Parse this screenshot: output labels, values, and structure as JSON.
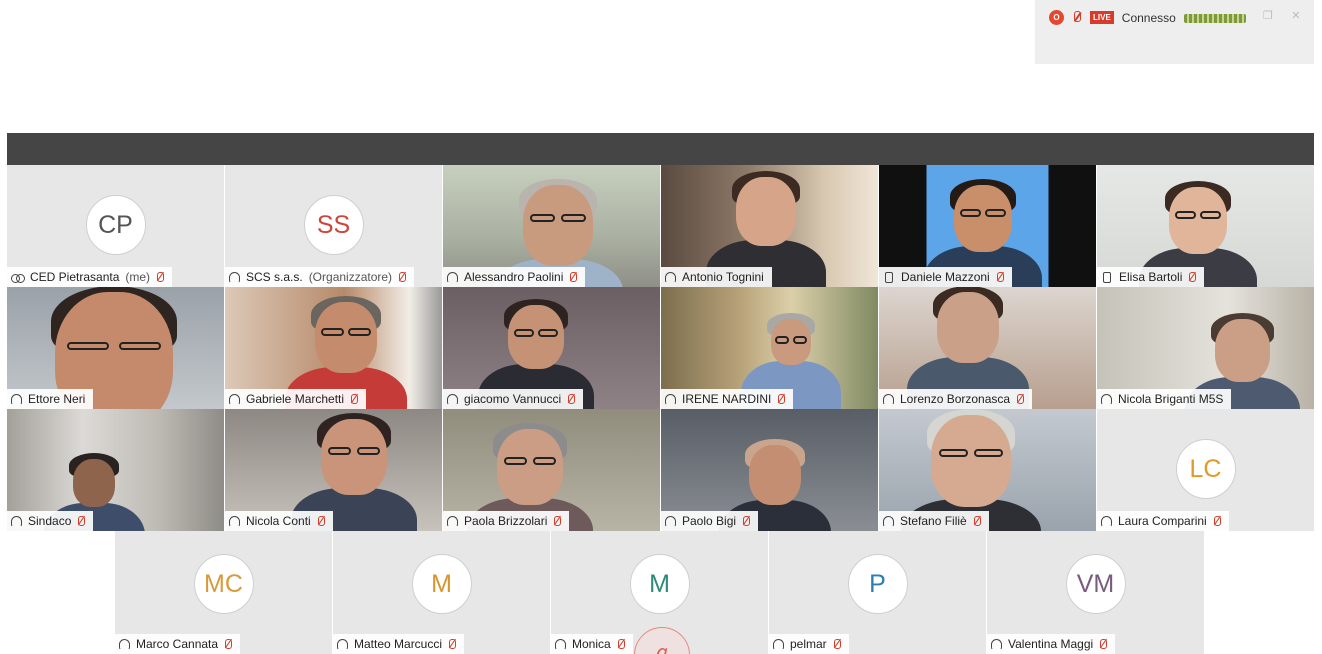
{
  "status": {
    "rec": "O",
    "live": "LIVE",
    "connection": "Connesso",
    "restore": "❐",
    "close": "✕"
  },
  "participants": [
    {
      "name": "CED Pietrasanta",
      "role": "(me)",
      "avatar": "CP",
      "avatar_color": "#555555",
      "icon": "people-icon",
      "muted": true
    },
    {
      "name": "SCS s.a.s.",
      "role": "(Organizzatore)",
      "avatar": "SS",
      "avatar_color": "#d0453a",
      "icon": "headset-icon",
      "muted": true
    },
    {
      "name": "Alessandro Paolini",
      "icon": "headset-icon",
      "muted": true
    },
    {
      "name": "Antonio Tognini",
      "icon": "headset-icon",
      "muted": false
    },
    {
      "name": "Daniele Mazzoni",
      "icon": "phone-icon",
      "muted": true
    },
    {
      "name": "Elisa Bartoli",
      "icon": "phone-icon",
      "muted": true
    },
    {
      "name": "Ettore Neri",
      "icon": "headset-icon",
      "muted": false
    },
    {
      "name": "Gabriele Marchetti",
      "icon": "headset-icon",
      "muted": true
    },
    {
      "name": "giacomo Vannucci",
      "icon": "headset-icon",
      "muted": true
    },
    {
      "name": "IRENE NARDINI",
      "icon": "headset-icon",
      "muted": true
    },
    {
      "name": "Lorenzo Borzonasca",
      "icon": "headset-icon",
      "muted": true
    },
    {
      "name": "Nicola Briganti M5S",
      "icon": "headset-icon",
      "muted": false
    },
    {
      "name": "Sindaco",
      "icon": "headset-icon",
      "muted": true
    },
    {
      "name": "Nicola Conti",
      "icon": "headset-icon",
      "muted": true
    },
    {
      "name": "Paola Brizzolari",
      "icon": "headset-icon",
      "muted": true
    },
    {
      "name": "Paolo Bigi",
      "icon": "headset-icon",
      "muted": true
    },
    {
      "name": "Stefano Filiè",
      "icon": "headset-icon",
      "muted": true
    },
    {
      "name": "Laura Comparini",
      "avatar": "LC",
      "avatar_color": "#e09a2a",
      "icon": "headset-icon",
      "muted": true
    }
  ],
  "bottom_participants": [
    {
      "name": "Marco Cannata",
      "avatar": "MC",
      "avatar_color": "#d89a3a",
      "icon": "headset-icon",
      "muted": true
    },
    {
      "name": "Matteo Marcucci",
      "avatar": "M",
      "avatar_color": "#d8952e",
      "icon": "headset-icon",
      "muted": true
    },
    {
      "name": "Monica",
      "avatar": "M",
      "avatar_color": "#2e8a7a",
      "icon": "headset-icon",
      "muted": true
    },
    {
      "name": "pelmar",
      "avatar": "P",
      "avatar_color": "#2a7fb0",
      "icon": "headset-icon",
      "muted": true
    },
    {
      "name": "Valentina Maggi",
      "avatar": "VM",
      "avatar_color": "#7a5a80",
      "icon": "headset-icon",
      "muted": true
    }
  ],
  "floating_mute_icon": "ℊ"
}
